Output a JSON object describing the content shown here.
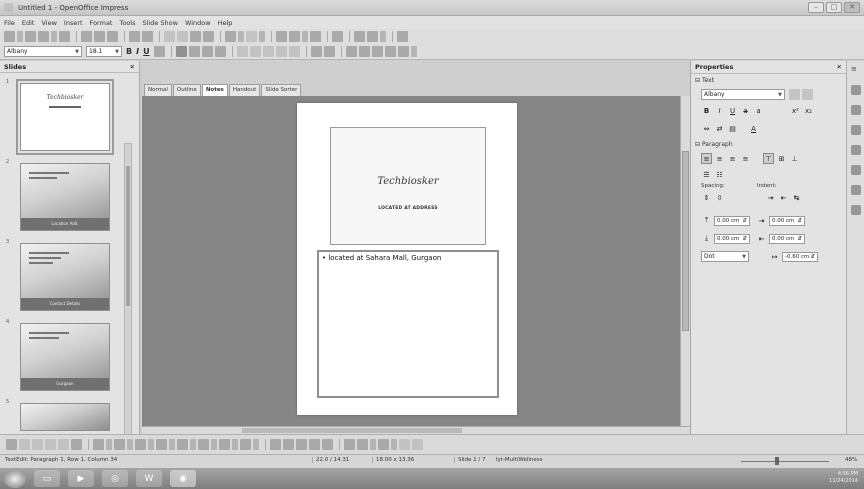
{
  "window": {
    "title": "Untitled 1 - OpenOffice Impress"
  },
  "menu": [
    "File",
    "Edit",
    "View",
    "Insert",
    "Format",
    "Tools",
    "Slide Show",
    "Window",
    "Help"
  ],
  "toolbar2": {
    "font_name": "Albany",
    "font_size": "18.1"
  },
  "slides_pane": {
    "title": "Slides",
    "thumbs": [
      {
        "num": "1",
        "title": "Techbiosker",
        "footer": ""
      },
      {
        "num": "2",
        "title": "",
        "footer": "Location Add."
      },
      {
        "num": "3",
        "title": "",
        "footer": "Contact Details"
      },
      {
        "num": "4",
        "title": "",
        "footer": "Gurgaon"
      },
      {
        "num": "5",
        "title": "",
        "footer": ""
      }
    ]
  },
  "view_tabs": [
    "Normal",
    "Outline",
    "Notes",
    "Handout",
    "Slide Sorter"
  ],
  "active_tab": "Notes",
  "slide": {
    "title": "Techbiosker",
    "subtitle": "LOCATED AT ADDRESS",
    "notes": "located at Sahara Mall, Gurgaon"
  },
  "properties": {
    "title": "Properties",
    "text_section": "Text",
    "font": "Albany",
    "paragraph_section": "Paragraph",
    "spacing_label": "Spacing:",
    "indent_label": "Indent:",
    "spin": [
      {
        "v1": "0.00 cm",
        "v2": "0.00 cm"
      },
      {
        "v1": "0.00 cm",
        "v2": "0.00 cm"
      },
      {
        "v1": "Dot",
        "v2": "-0.60 cm"
      }
    ]
  },
  "status": {
    "left": "TextEdit: Paragraph 1, Row 1, Column 34",
    "pos": "22.0 / 14.31",
    "size": "18.00 x 13.36",
    "slide": "Slide 1 / 7",
    "layout": "lyt-MultiWellness",
    "zoom": "48%"
  },
  "taskbar": {
    "tray_time": "4:56 PM",
    "tray_date": "11/24/2014"
  }
}
